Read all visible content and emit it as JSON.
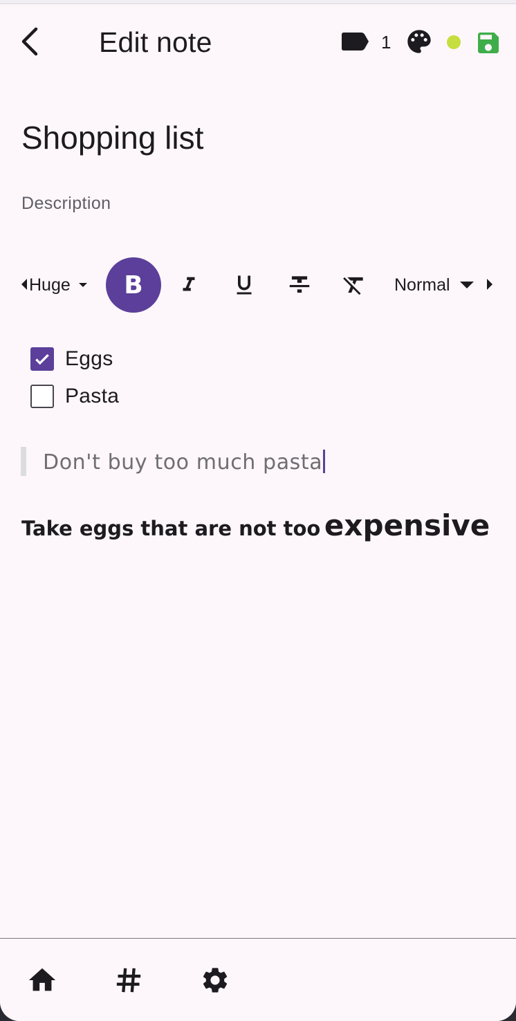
{
  "app_bar": {
    "title": "Edit note",
    "back_icon": "arrow-back-icon",
    "tag_icon": "label-icon",
    "tag_count": "1",
    "palette_icon": "palette-icon",
    "color_indicator": "#c6de3f",
    "save_icon": "save-icon",
    "save_color": "#3fae4a"
  },
  "note": {
    "title": "Shopping list",
    "description_placeholder": "Description"
  },
  "toolbar": {
    "size_value": "Huge",
    "heading_value": "Normal",
    "bold_label": "B",
    "buttons": [
      "bold-icon",
      "italic-icon",
      "underline-icon",
      "strikethrough-icon",
      "clear-format-icon"
    ],
    "accent": "#5b3f9a"
  },
  "content": {
    "checklist": [
      {
        "label": "Eggs",
        "checked": true
      },
      {
        "label": "Pasta",
        "checked": false
      }
    ],
    "quote": "Don't buy too much pasta",
    "paragraph_normal": "Take eggs that are not too",
    "paragraph_huge": "expensive"
  },
  "bottom_nav": {
    "items": [
      "home-icon",
      "tag-icon",
      "settings-icon"
    ]
  }
}
